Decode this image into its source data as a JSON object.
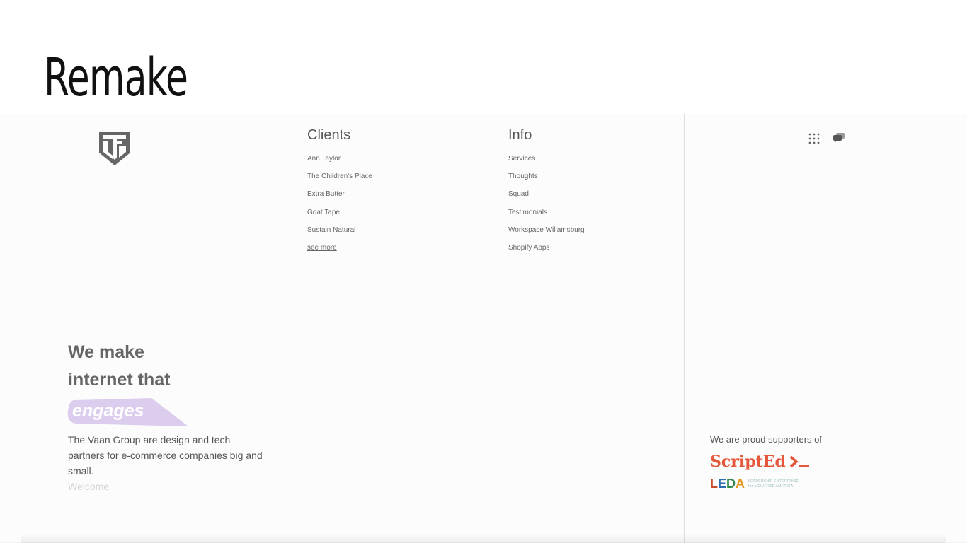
{
  "slide": {
    "title": "Remake"
  },
  "brand": {
    "logo_icon": "tvg-shield-logo-icon"
  },
  "hero": {
    "line1": "We make",
    "line2": "internet that",
    "highlight": "engages",
    "highlight_color": "#d9c9ec",
    "description": "The Vaan Group are design and tech partners for e-commerce companies big and small.",
    "welcome": "Welcome"
  },
  "clients": {
    "title": "Clients",
    "items": [
      "Ann Taylor",
      "The Children's Place",
      "Extra Butter",
      "Goat Tape",
      "Sustain Natural",
      "see more"
    ]
  },
  "info": {
    "title": "Info",
    "items": [
      "Services",
      "Thoughts",
      "Squad",
      "Testimonials",
      "Workspace Willamsburg",
      "Shopify Apps"
    ]
  },
  "toolbar": {
    "grid_icon": "grid-dots-icon",
    "chat_icon": "chat-bubbles-icon"
  },
  "supporters": {
    "text": "We are proud supporters of",
    "scripted": "ScriptEd",
    "scripted_color": "#e4573a",
    "leda": "LEDA",
    "leda_sub_line1": "LEADERSHIP ENTERPRISE",
    "leda_sub_line2": "for a DIVERSE AMERICA"
  }
}
